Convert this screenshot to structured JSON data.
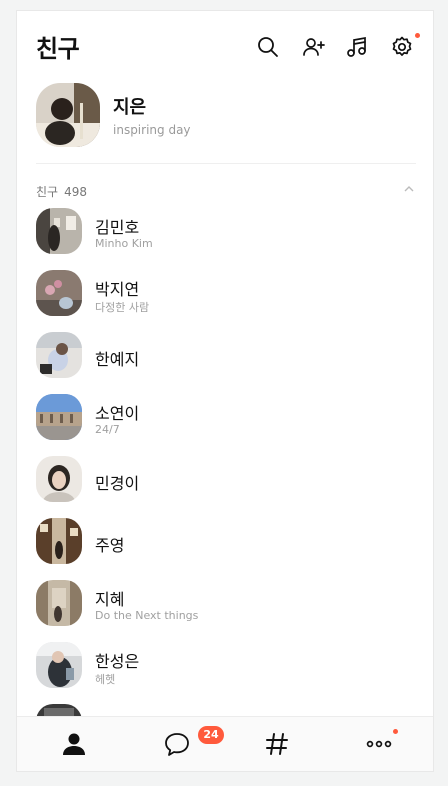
{
  "header": {
    "title": "친구"
  },
  "profile": {
    "name": "지은",
    "status": "inspiring day"
  },
  "section": {
    "label": "친구",
    "count": "498"
  },
  "friends": [
    {
      "name": "김민호",
      "status": "Minho Kim"
    },
    {
      "name": "박지연",
      "status": "다정한 사람"
    },
    {
      "name": "한예지",
      "status": ""
    },
    {
      "name": "소연이",
      "status": "24/7"
    },
    {
      "name": "민경이",
      "status": ""
    },
    {
      "name": "주영",
      "status": ""
    },
    {
      "name": "지혜",
      "status": "Do the Next things"
    },
    {
      "name": "한성은",
      "status": "헤헷"
    }
  ],
  "tabbar": {
    "chat_badge": "24"
  },
  "colors": {
    "accent": "#ff5a3c",
    "text": "#111111",
    "subtext": "#9a9a9a"
  }
}
